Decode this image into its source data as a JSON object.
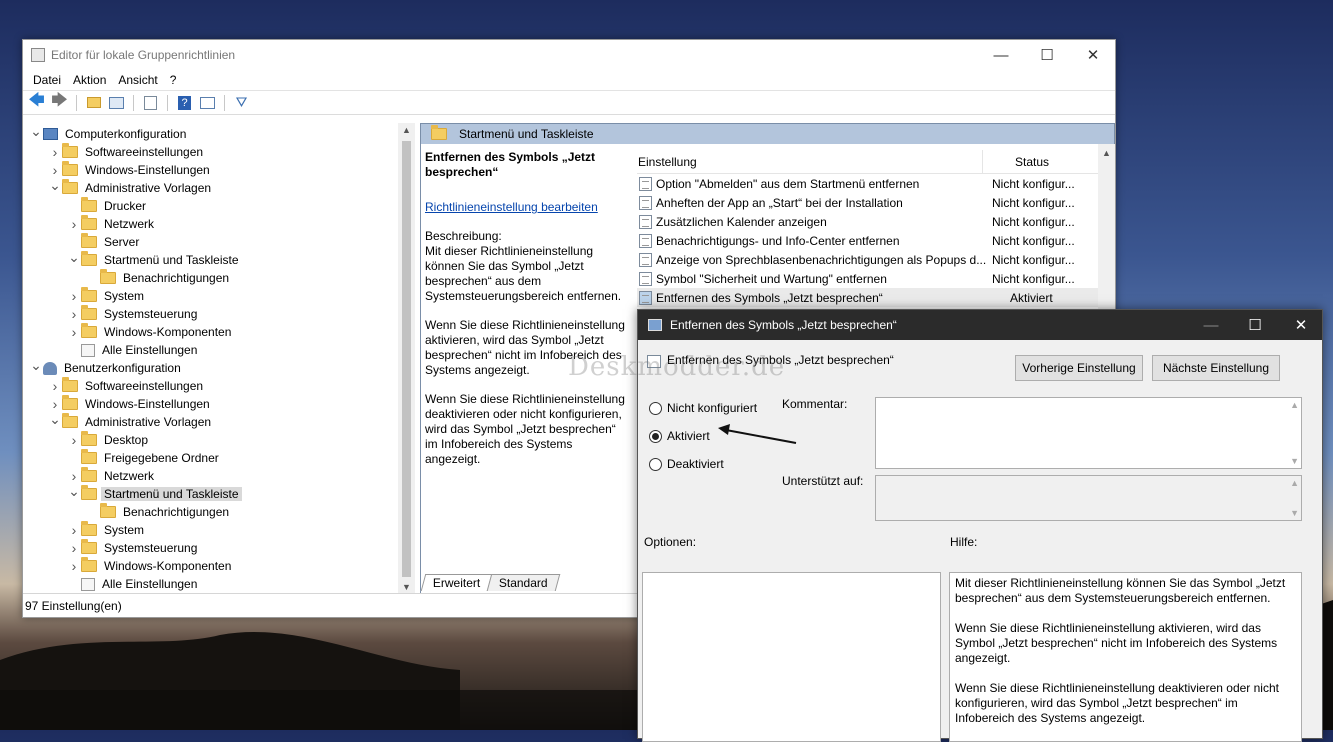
{
  "main_window": {
    "title": "Editor für lokale Gruppenrichtlinien",
    "menu": [
      "Datei",
      "Aktion",
      "Ansicht",
      "?"
    ],
    "status": "97 Einstellung(en)"
  },
  "tree": {
    "items": [
      {
        "label": "Computerkonfiguration",
        "level": 0,
        "exp": "open",
        "kind": "pc"
      },
      {
        "label": "Softwareeinstellungen",
        "level": 1,
        "exp": "closed",
        "kind": "folder"
      },
      {
        "label": "Windows-Einstellungen",
        "level": 1,
        "exp": "closed",
        "kind": "folder"
      },
      {
        "label": "Administrative Vorlagen",
        "level": 1,
        "exp": "open",
        "kind": "folder"
      },
      {
        "label": "Drucker",
        "level": 2,
        "exp": "none",
        "kind": "folder"
      },
      {
        "label": "Netzwerk",
        "level": 2,
        "exp": "closed",
        "kind": "folder"
      },
      {
        "label": "Server",
        "level": 2,
        "exp": "none",
        "kind": "folder"
      },
      {
        "label": "Startmenü und Taskleiste",
        "level": 2,
        "exp": "open",
        "kind": "folder"
      },
      {
        "label": "Benachrichtigungen",
        "level": 3,
        "exp": "none",
        "kind": "folder"
      },
      {
        "label": "System",
        "level": 2,
        "exp": "closed",
        "kind": "folder"
      },
      {
        "label": "Systemsteuerung",
        "level": 2,
        "exp": "closed",
        "kind": "folder"
      },
      {
        "label": "Windows-Komponenten",
        "level": 2,
        "exp": "closed",
        "kind": "folder"
      },
      {
        "label": "Alle Einstellungen",
        "level": 2,
        "exp": "none",
        "kind": "all"
      },
      {
        "label": "Benutzerkonfiguration",
        "level": 0,
        "exp": "open",
        "kind": "user"
      },
      {
        "label": "Softwareeinstellungen",
        "level": 1,
        "exp": "closed",
        "kind": "folder"
      },
      {
        "label": "Windows-Einstellungen",
        "level": 1,
        "exp": "closed",
        "kind": "folder"
      },
      {
        "label": "Administrative Vorlagen",
        "level": 1,
        "exp": "open",
        "kind": "folder"
      },
      {
        "label": "Desktop",
        "level": 2,
        "exp": "closed",
        "kind": "folder"
      },
      {
        "label": "Freigegebene Ordner",
        "level": 2,
        "exp": "none",
        "kind": "folder"
      },
      {
        "label": "Netzwerk",
        "level": 2,
        "exp": "closed",
        "kind": "folder"
      },
      {
        "label": "Startmenü und Taskleiste",
        "level": 2,
        "exp": "open",
        "kind": "folder",
        "selected": true
      },
      {
        "label": "Benachrichtigungen",
        "level": 3,
        "exp": "none",
        "kind": "folder"
      },
      {
        "label": "System",
        "level": 2,
        "exp": "closed",
        "kind": "folder"
      },
      {
        "label": "Systemsteuerung",
        "level": 2,
        "exp": "closed",
        "kind": "folder"
      },
      {
        "label": "Windows-Komponenten",
        "level": 2,
        "exp": "closed",
        "kind": "folder"
      },
      {
        "label": "Alle Einstellungen",
        "level": 2,
        "exp": "none",
        "kind": "all"
      }
    ]
  },
  "right_pane": {
    "header": "Startmenü und Taskleiste",
    "desc_title": "Entfernen des Symbols „Jetzt besprechen“",
    "edit_link": "Richtlinieneinstellung bearbeiten",
    "desc_p1": "Beschreibung:\nMit dieser Richtlinieneinstellung können Sie das Symbol „Jetzt besprechen“ aus dem Systemsteuerungsbereich entfernen.",
    "desc_p2": "Wenn Sie diese Richtlinieneinstellung aktivieren, wird das Symbol „Jetzt besprechen“ nicht im Infobereich des Systems angezeigt.",
    "desc_p3": "Wenn Sie diese Richtlinieneinstellung deaktivieren oder nicht konfigurieren, wird das Symbol „Jetzt besprechen“ im Infobereich des Systems angezeigt.",
    "col_setting": "Einstellung",
    "col_status": "Status",
    "rows": [
      {
        "name": "Option \"Abmelden\" aus dem Startmenü entfernen",
        "status": "Nicht konfigur..."
      },
      {
        "name": "Anheften der App an „Start“ bei der Installation",
        "status": "Nicht konfigur..."
      },
      {
        "name": "Zusätzlichen Kalender anzeigen",
        "status": "Nicht konfigur..."
      },
      {
        "name": "Benachrichtigungs- und Info-Center entfernen",
        "status": "Nicht konfigur..."
      },
      {
        "name": "Anzeige von Sprechblasenbenachrichtigungen als Popups d...",
        "status": "Nicht konfigur..."
      },
      {
        "name": "Symbol \"Sicherheit und Wartung\" entfernen",
        "status": "Nicht konfigur..."
      },
      {
        "name": "Entfernen des Symbols „Jetzt besprechen“",
        "status": "Aktiviert",
        "selected": true
      }
    ],
    "tab_extended": "Erweitert",
    "tab_standard": "Standard"
  },
  "dialog": {
    "title": "Entfernen des Symbols „Jetzt besprechen“",
    "subtitle": "Entfernen des Symbols „Jetzt besprechen“",
    "prev_button": "Vorherige Einstellung",
    "next_button": "Nächste Einstellung",
    "radio_not_configured": "Nicht konfiguriert",
    "radio_enabled": "Aktiviert",
    "radio_disabled": "Deaktiviert",
    "selected_state": "Aktiviert",
    "comment_label": "Kommentar:",
    "supported_label": "Unterstützt auf:",
    "options_label": "Optionen:",
    "help_label": "Hilfe:",
    "help_p1": "Mit dieser Richtlinieneinstellung können Sie das Symbol „Jetzt besprechen“ aus dem Systemsteuerungsbereich entfernen.",
    "help_p2": "Wenn Sie diese Richtlinieneinstellung aktivieren, wird das Symbol „Jetzt besprechen“ nicht im Infobereich des Systems angezeigt.",
    "help_p3": "Wenn Sie diese Richtlinieneinstellung deaktivieren oder nicht konfigurieren, wird das Symbol „Jetzt besprechen“ im Infobereich des Systems angezeigt."
  },
  "watermark": "Deskmodder.de"
}
